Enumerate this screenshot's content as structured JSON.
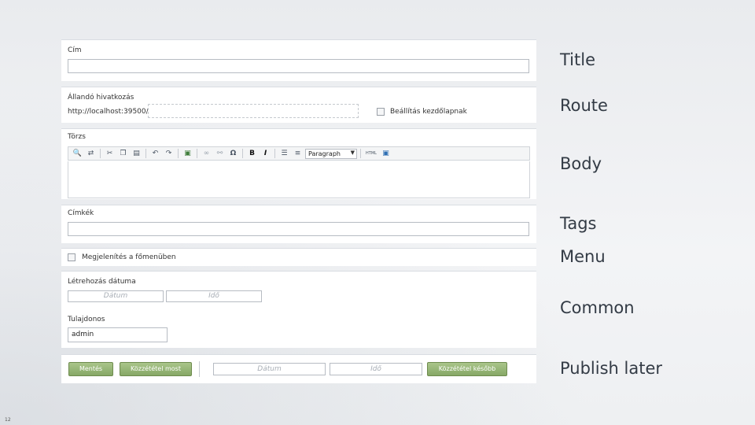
{
  "form": {
    "title": {
      "label": "Cím",
      "value": ""
    },
    "route": {
      "label": "Állandó hivatkozás",
      "prefix": "http://localhost:39500/",
      "value": "",
      "homepage_label": "Beállítás kezdőlapnak"
    },
    "body": {
      "label": "Törzs",
      "format_selected": "Paragraph",
      "html_label": "HTML"
    },
    "tags": {
      "label": "Címkék",
      "value": ""
    },
    "menu": {
      "label": "Megjelenítés a főmenüben"
    },
    "common": {
      "created_label": "Létrehozás dátuma",
      "date_placeholder": "Dátum",
      "time_placeholder": "Idő",
      "owner_label": "Tulajdonos",
      "owner_value": "admin"
    },
    "publish": {
      "save_label": "Mentés",
      "publish_now_label": "Közzététel most",
      "date_placeholder": "Dátum",
      "time_placeholder": "Idő",
      "publish_later_label": "Közzététel később"
    }
  },
  "side_labels": {
    "title": "Title",
    "route": "Route",
    "body": "Body",
    "tags": "Tags",
    "menu": "Menu",
    "common": "Common",
    "publish_later": "Publish later"
  },
  "page_number": "12",
  "icons": [
    "find-icon",
    "replace-icon",
    "cut-icon",
    "copy-icon",
    "paste-icon",
    "undo-icon",
    "redo-icon",
    "image-icon",
    "link-icon",
    "unlink-icon",
    "omega-icon",
    "bold-icon",
    "italic-icon",
    "ordered-list-icon",
    "bullet-list-icon",
    "html-icon",
    "media-icon"
  ],
  "colors": {
    "button_green": "#8fae6d",
    "panel_bg": "#ffffff",
    "label_text": "#333b45"
  }
}
